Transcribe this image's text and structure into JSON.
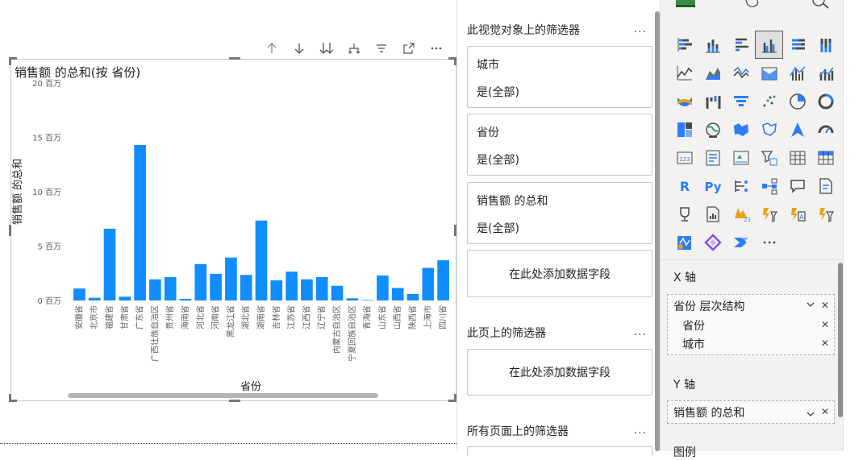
{
  "visual": {
    "title": "销售额 的总和(按 省份)",
    "header_icons": [
      "arrow-up-icon",
      "arrow-down-icon",
      "expand-all-down-icon",
      "drill-fork-icon",
      "filter-icon",
      "focus-mode-icon",
      "more-options-icon"
    ]
  },
  "chart_data": {
    "type": "bar",
    "title": "销售额 的总和(按 省份)",
    "xlabel": "省份",
    "ylabel": "销售额 的总和",
    "ylim": [
      0,
      20
    ],
    "yticks": [
      "0 百万",
      "5 百万",
      "10 百万",
      "15 百万",
      "20 百万"
    ],
    "ytick_values": [
      0,
      5,
      10,
      15,
      20
    ],
    "grid": false,
    "color": "#118DFF",
    "categories": [
      "安徽省",
      "北京市",
      "福建省",
      "甘肃省",
      "广东省",
      "广西壮族自治区",
      "贵州省",
      "海南省",
      "河北省",
      "河南省",
      "黑龙江省",
      "湖北省",
      "湖南省",
      "吉林省",
      "江苏省",
      "江西省",
      "辽宁省",
      "内蒙古自治区",
      "宁夏回族自治区",
      "青海省",
      "山东省",
      "山西省",
      "陕西省",
      "上海市",
      "四川省"
    ],
    "values": [
      1.1,
      0.25,
      6.6,
      0.35,
      14.3,
      1.95,
      2.15,
      0.15,
      3.35,
      2.45,
      3.95,
      2.35,
      7.35,
      1.85,
      2.65,
      1.95,
      2.15,
      1.35,
      0.2,
      0.05,
      2.3,
      1.15,
      0.6,
      3.0,
      3.7
    ]
  },
  "filters": {
    "visual_section": "此视觉对象上的筛选器",
    "page_section": "此页上的筛选器",
    "all_section": "所有页面上的筛选器",
    "more": "...",
    "cards": [
      {
        "name": "城市",
        "value": "是(全部)"
      },
      {
        "name": "省份",
        "value": "是(全部)"
      },
      {
        "name": "销售额 的总和",
        "value": "是(全部)"
      }
    ],
    "add_field": "在此处添加数据字段"
  },
  "viz_pane": {
    "icons": [
      "stacked-bar-icon",
      "stacked-column-icon",
      "clustered-bar-icon",
      "clustered-column-icon",
      "100-stacked-bar-icon",
      "100-stacked-column-icon",
      "line-chart-icon",
      "area-chart-icon",
      "stacked-area-icon",
      "ribbon-chart-icon",
      "line-clustered-column-icon",
      "line-stacked-column-icon",
      "ribbon-icon",
      "waterfall-icon",
      "funnel-icon",
      "scatter-icon",
      "pie-icon",
      "donut-icon",
      "treemap-icon",
      "map-icon",
      "filled-map-icon",
      "shape-map-icon",
      "azure-map-icon",
      "gauge-icon",
      "card-icon",
      "multi-row-card-icon",
      "kpi-icon",
      "slicer-icon",
      "table-icon",
      "matrix-icon",
      "r-visual-icon",
      "python-visual-icon",
      "key-influencers-icon",
      "decomposition-tree-icon",
      "qa-icon",
      "smart-narrative-icon",
      "trophy-icon",
      "paginated-report-icon",
      "power-apps-icon",
      "power-automate-icon",
      "arcgis-icon",
      "custom-visual-icon",
      "metrics-icon",
      "power-apps-alt-icon",
      "power-automate-alt-icon",
      "more-visuals-icon"
    ],
    "more_label": "...",
    "x_axis_label": "X 轴",
    "x_hierarchy": "省份 层次结构",
    "x_levels": [
      "省份",
      "城市"
    ],
    "y_axis_label": "Y 轴",
    "y_field": "销售额 的总和",
    "legend_label": "图例"
  }
}
